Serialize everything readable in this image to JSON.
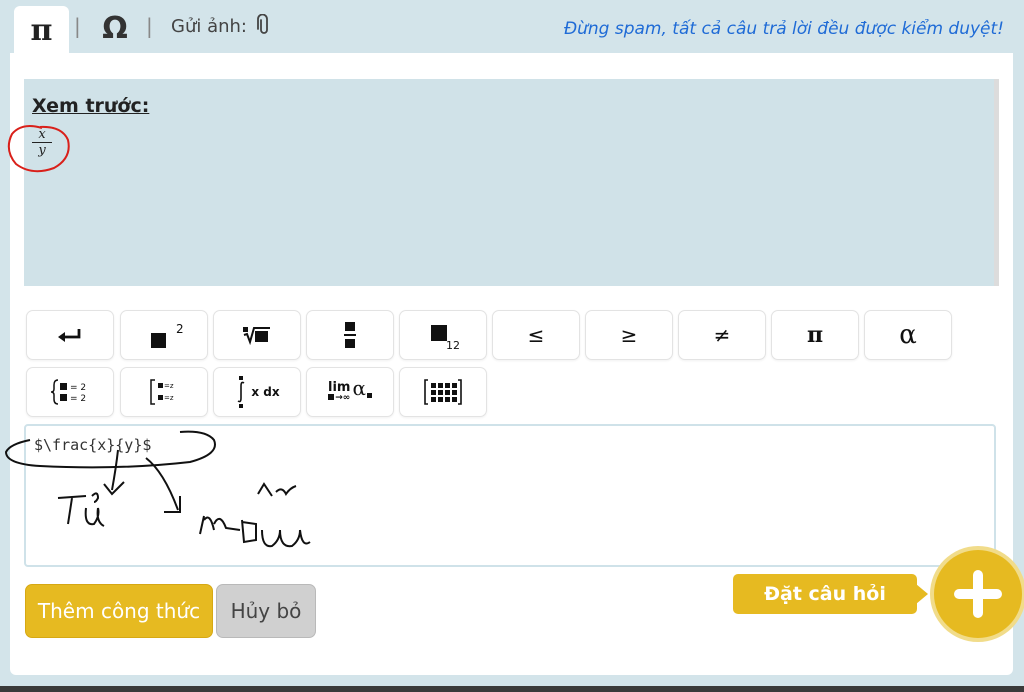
{
  "tabs": {
    "symbol_pi": "π",
    "symbol_omega": "Ω",
    "separator": "|",
    "upload_label": "Gửi ảnh:"
  },
  "notice": "Đừng spam, tất cả câu trả lời đều được kiểm duyệt!",
  "preview": {
    "title": "Xem trước:",
    "fraction": {
      "numerator": "x",
      "denominator": "y"
    }
  },
  "toolbar": {
    "row1": [
      "↵",
      "■²",
      "√■",
      "■/■",
      "■₁₂",
      "≤",
      "≥",
      "≠",
      "π",
      "α"
    ],
    "row2": [
      "{■=2 ■=2",
      "[■=z ■=z",
      "∫ x dx",
      "lim α",
      "[⠿]"
    ],
    "labels": {
      "power_exp": "2",
      "subscript": "12",
      "integral": "x dx",
      "lim": "lim",
      "lim_sub": "→∞",
      "alpha": "α",
      "system_eq": "= 2",
      "bracket_eq": "=z"
    }
  },
  "editor": {
    "value": "$\\frac{x}{y}$"
  },
  "buttons": {
    "add_formula": "Thêm công thức",
    "cancel": "Hủy bỏ",
    "ask_question": "Đặt câu hỏi"
  },
  "colors": {
    "accent": "#e6ba21",
    "link_blue": "#1f6bd6",
    "preview_bg": "#d0e2e8",
    "page_bg": "#d3e4ea"
  }
}
